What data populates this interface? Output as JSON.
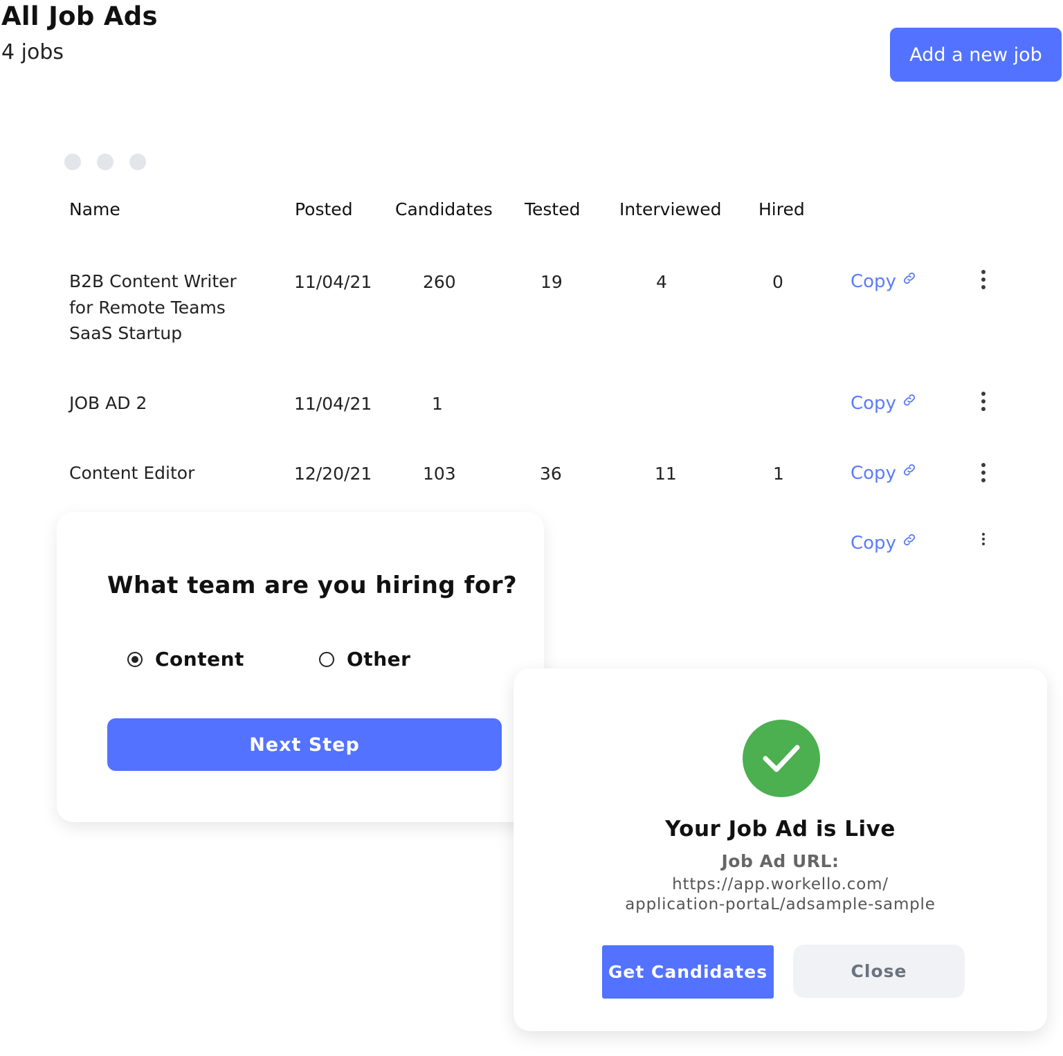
{
  "header": {
    "title": "All Job Ads",
    "count": "4 jobs",
    "add_button": "Add a new job"
  },
  "table": {
    "columns": [
      "Name",
      "Posted",
      "Candidates",
      "Tested",
      "Interviewed",
      "Hired"
    ],
    "copy_label": "Copy",
    "rows": [
      {
        "name": [
          "B2B Content Writer",
          "for Remote Teams",
          "SaaS Startup"
        ],
        "posted": "11/04/21",
        "candidates": "260",
        "tested": "19",
        "interviewed": "4",
        "hired": "0"
      },
      {
        "name": [
          "JOB AD 2"
        ],
        "posted": "11/04/21",
        "candidates": "1",
        "tested": "",
        "interviewed": "",
        "hired": ""
      },
      {
        "name": [
          "Content Editor"
        ],
        "posted": "12/20/21",
        "candidates": "103",
        "tested": "36",
        "interviewed": "11",
        "hired": "1"
      },
      {
        "name": [],
        "posted": "",
        "candidates": "",
        "tested": "",
        "interviewed": "",
        "hired": ""
      }
    ]
  },
  "team_card": {
    "question": "What team are you hiring for?",
    "options": [
      {
        "label": "Content",
        "selected": true
      },
      {
        "label": "Other",
        "selected": false
      }
    ],
    "next_button": "Next Step"
  },
  "live_card": {
    "title": "Your Job Ad is Live",
    "url_label": "Job Ad URL:",
    "url_lines": [
      "https://app.workello.com/",
      "application-portaL/adsample-sample"
    ],
    "get_button": "Get Candidates",
    "close_button": "Close",
    "icon": "check-icon"
  },
  "colors": {
    "primary": "#5272ff",
    "link": "#5b7cfa",
    "success": "#4caf50",
    "secondary_bg": "#f1f2f5"
  }
}
